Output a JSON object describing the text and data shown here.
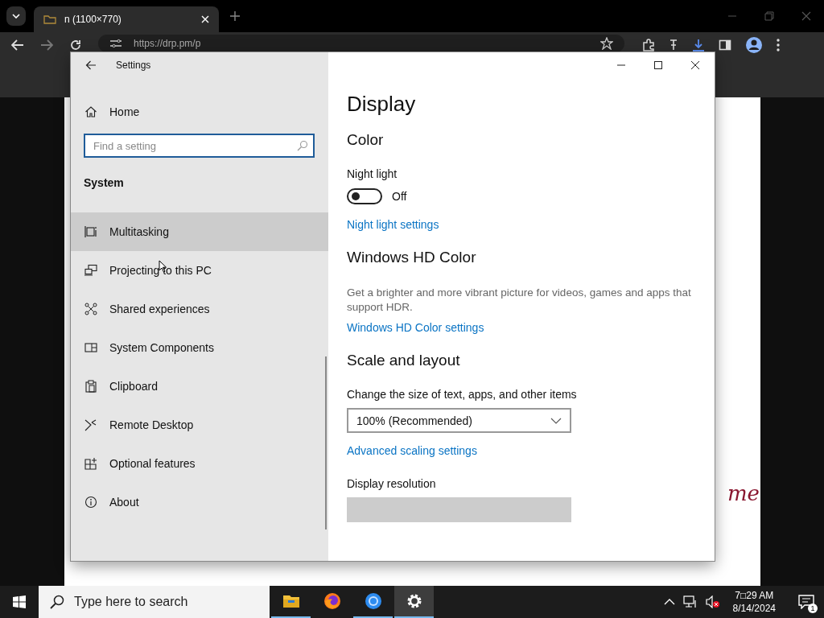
{
  "browser": {
    "tab": {
      "title": "n (1100×770)",
      "selected": true
    },
    "address": "https://drp.pm/p",
    "page_text": "me"
  },
  "settings": {
    "title": "Settings",
    "home": "Home",
    "search": {
      "placeholder": "Find a setting"
    },
    "section": "System",
    "nav_items": [
      {
        "label": "Multitasking",
        "selected": true
      },
      {
        "label": "Projecting to this PC",
        "selected": false
      },
      {
        "label": "Shared experiences",
        "selected": false
      },
      {
        "label": "System Components",
        "selected": false
      },
      {
        "label": "Clipboard",
        "selected": false
      },
      {
        "label": "Remote Desktop",
        "selected": false
      },
      {
        "label": "Optional features",
        "selected": false
      },
      {
        "label": "About",
        "selected": false
      }
    ],
    "content": [
      {
        "kind": "title",
        "text": "Display"
      },
      {
        "kind": "heading",
        "text": "Color"
      },
      {
        "kind": "label",
        "text": "Night light"
      },
      {
        "kind": "toggle",
        "on": false,
        "text": "Off"
      },
      {
        "kind": "link",
        "text": "Night light settings"
      },
      {
        "kind": "heading",
        "text": "Windows HD Color"
      },
      {
        "kind": "description",
        "text": "Get a brighter and more vibrant picture for videos, games and apps that support HDR."
      },
      {
        "kind": "link",
        "text": "Windows HD Color settings"
      },
      {
        "kind": "heading",
        "text": "Scale and layout"
      },
      {
        "kind": "label",
        "text": "Change the size of text, apps, and other items"
      },
      {
        "kind": "dropdown",
        "value": "100% (Recommended)",
        "disabled": false
      },
      {
        "kind": "link",
        "text": "Advanced scaling settings"
      },
      {
        "kind": "label",
        "text": "Display resolution"
      },
      {
        "kind": "dropdown",
        "disabled": true
      }
    ]
  },
  "taskbar": {
    "search": {
      "placeholder": "Type here to search"
    },
    "apps": [
      {
        "running": true,
        "selected": false
      },
      {
        "running": false,
        "selected": false
      },
      {
        "running": true,
        "selected": false
      },
      {
        "running": true,
        "selected": true
      }
    ],
    "time": "7□29 AM",
    "date": "8/14/2024",
    "notifications": "1"
  }
}
